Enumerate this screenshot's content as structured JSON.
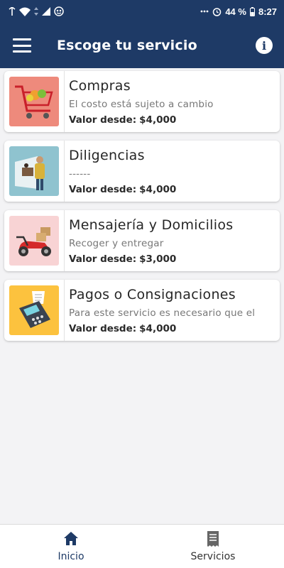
{
  "status_bar": {
    "battery": "44 %",
    "time": "8:27",
    "icons": [
      "signal-icon",
      "wifi-icon",
      "data-arrows-icon",
      "cellular-icon",
      "app-badge-icon",
      "dots-icon",
      "alarm-icon",
      "battery-icon"
    ]
  },
  "header": {
    "title": "Escoge tu servicio",
    "menu_icon": "hamburger-menu-icon",
    "info_icon": "info-icon"
  },
  "services": [
    {
      "title": "Compras",
      "subtitle": "El costo está sujeto a cambio",
      "price_label": "Valor desde:",
      "price": "$4,000",
      "image": "shopping-cart-image",
      "thumb_color": "#ee8a7c"
    },
    {
      "title": "Diligencias",
      "subtitle": "------",
      "price_label": "Valor desde:",
      "price": "$4,000",
      "image": "clerk-window-image",
      "thumb_color": "#8fc3cf"
    },
    {
      "title": "Mensajería y Domicilios",
      "subtitle": "Recoger y entregar",
      "price_label": "Valor desde:",
      "price": "$3,000",
      "image": "delivery-scooter-image",
      "thumb_color": "#f8d3d4"
    },
    {
      "title": "Pagos o Consignaciones",
      "subtitle": "Para este servicio es necesario que el",
      "price_label": "Valor desde:",
      "price": "$4,000",
      "image": "card-terminal-image",
      "thumb_color": "#fcc23e"
    }
  ],
  "bottom_nav": {
    "items": [
      {
        "label": "Inicio",
        "icon": "home-icon",
        "active": true
      },
      {
        "label": "Servicios",
        "icon": "receipt-icon",
        "active": false
      }
    ]
  },
  "colors": {
    "primary": "#1e3a66",
    "background": "#f3f3f5"
  }
}
